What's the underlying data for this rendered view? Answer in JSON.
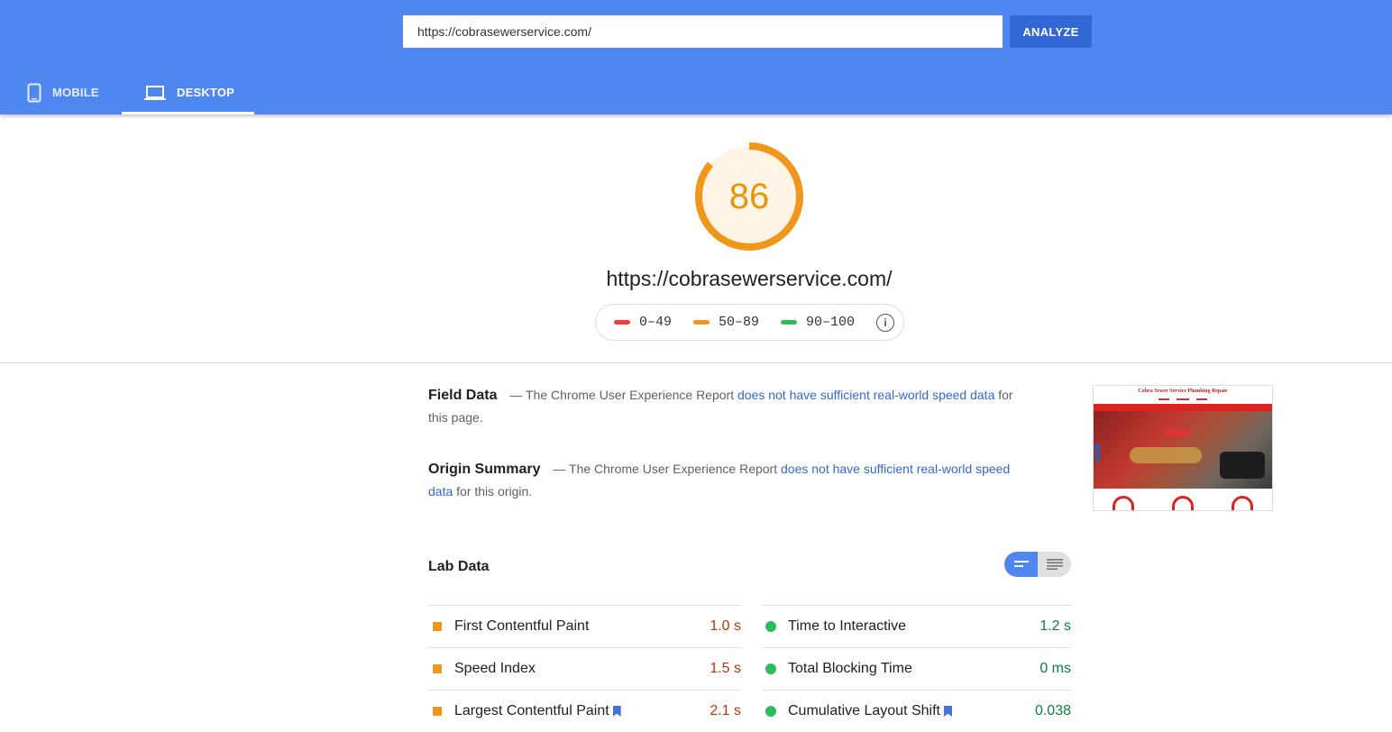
{
  "header": {
    "url_value": "https://cobrasewerservice.com/",
    "analyze_label": "ANALYZE",
    "tabs": [
      {
        "label": "MOBILE",
        "icon": "phone-icon",
        "selected": false
      },
      {
        "label": "DESKTOP",
        "icon": "laptop-icon",
        "selected": true
      }
    ]
  },
  "score": {
    "value": "86",
    "fraction": 0.86,
    "color": "#f0961a",
    "url": "https://cobrasewerservice.com/"
  },
  "legend": [
    {
      "range": "0–49",
      "color": "#f33b3b"
    },
    {
      "range": "50–89",
      "color": "#f0961a"
    },
    {
      "range": "90–100",
      "color": "#2bbd5b"
    }
  ],
  "field_data": {
    "title": "Field Data",
    "pre": "— The Chrome User Experience Report",
    "link": "does not have sufficient real-world speed data",
    "post": "for this page."
  },
  "origin_summary": {
    "title": "Origin Summary",
    "pre": "— The Chrome User Experience Report",
    "link": "does not have sufficient real-world speed data",
    "post": "for this origin."
  },
  "thumbnail": {
    "site_title": "Cobra Sewer Service Plumbing Repair"
  },
  "lab_data": {
    "title": "Lab Data",
    "left": [
      {
        "label": "First Contentful Paint",
        "value": "1.0 s",
        "status": "average"
      },
      {
        "label": "Speed Index",
        "value": "1.5 s",
        "status": "average"
      },
      {
        "label": "Largest Contentful Paint",
        "value": "2.1 s",
        "status": "average",
        "bookmark": true
      }
    ],
    "right": [
      {
        "label": "Time to Interactive",
        "value": "1.2 s",
        "status": "pass"
      },
      {
        "label": "Total Blocking Time",
        "value": "0 ms",
        "status": "pass"
      },
      {
        "label": "Cumulative Layout Shift",
        "value": "0.038",
        "status": "pass",
        "bookmark": true
      }
    ]
  }
}
